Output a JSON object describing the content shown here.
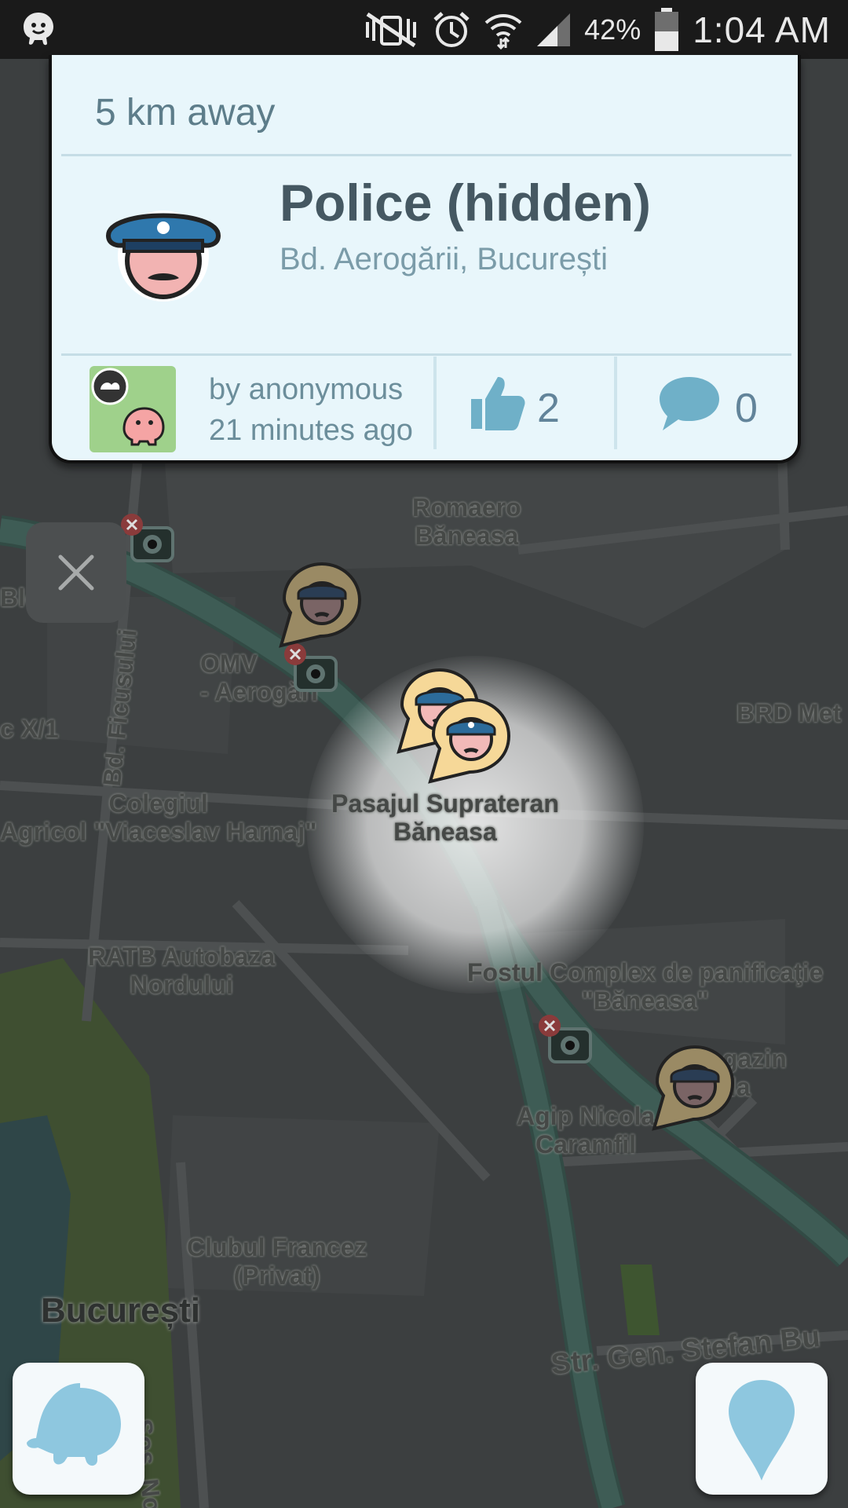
{
  "status_bar": {
    "battery_percent": "42%",
    "time": "1:04 AM",
    "icons": [
      "waze-notification-icon",
      "mute-vibrate-icon",
      "alarm-icon",
      "wifi-icon",
      "signal-icon",
      "battery-icon"
    ]
  },
  "card": {
    "distance": "5 km away",
    "title": "Police (hidden)",
    "address": "Bd. Aerogării, București",
    "reporter": "by anonymous",
    "time_ago": "21 minutes ago",
    "thumbs_up_count": "2",
    "comments_count": "0",
    "icon": "police-officer-icon"
  },
  "map": {
    "labels": {
      "romaero": "Romaero\nBăneasa",
      "bloc_v": "Bloc V",
      "omv": "OMV\n- Aerogări",
      "bd_ficusului": "Bd. Ficusului",
      "bloc_x1": "c X/1",
      "brd": "BRD Met",
      "pasajul": "Pasajul Suprateran\nBăneasa",
      "colegiul": "Colegiul\nAgricol \"Viaceslav Harnaj\"",
      "ratb": "RATB Autobaza\nNordului",
      "fostul": "Fostul Complex de panificaţie\n\"Băneasa\"",
      "magazin": "gazin\nila",
      "agip": "Agip Nicola\nCaramfil",
      "clubul": "Clubul Francez\n(Privat)",
      "bucuresti": "București",
      "sos_nord": "Șos. Nord",
      "str_gen": "Str. Gen. Stefan Bu"
    }
  },
  "buttons": {
    "close": "close-icon",
    "menu": "waze-menu-icon",
    "report": "report-pin-icon"
  }
}
